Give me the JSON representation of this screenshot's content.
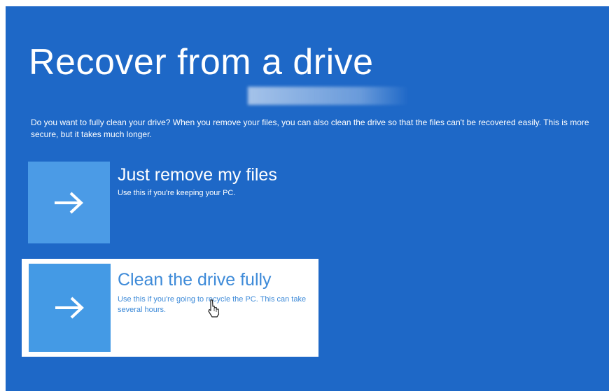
{
  "page": {
    "title": "Recover from a drive",
    "description": "Do you want to fully clean your drive? When you remove your files, you can also clean the drive so that the files can't be recovered easily. This is more secure, but it takes much longer."
  },
  "options": [
    {
      "title": "Just remove my files",
      "description": "Use this if you're keeping your PC.",
      "icon": "arrow-right-icon",
      "selected": false
    },
    {
      "title": "Clean the drive fully",
      "description": "Use this if you're going to recycle the PC. This can take several hours.",
      "icon": "arrow-right-icon",
      "selected": true
    }
  ],
  "colors": {
    "background": "#1e68c7",
    "tile": "#4b9be6",
    "selected_background": "#ffffff",
    "selected_text": "#3d8ad8"
  }
}
